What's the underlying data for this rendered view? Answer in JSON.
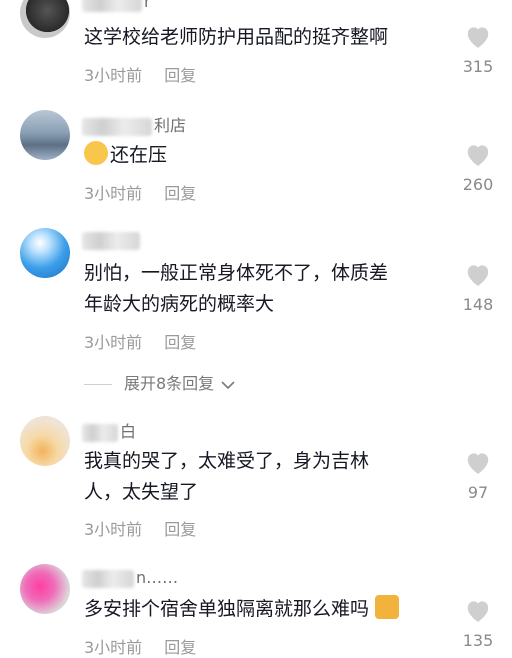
{
  "comments": [
    {
      "name": "r",
      "text_lines": [
        "这学校给老师防护用品配的挺齐整啊"
      ],
      "time": "3小时前",
      "reply": "回复",
      "likes": "315"
    },
    {
      "name": "利店",
      "emoji": "grinning-sweat-emoji",
      "text_lines": [
        "还在压"
      ],
      "time": "3小时前",
      "reply": "回复",
      "likes": "260"
    },
    {
      "name": "",
      "text_lines": [
        "别怕，一般正常身体死不了，体质差",
        "年龄大的病死的概率大"
      ],
      "time": "3小时前",
      "reply": "回复",
      "likes": "148",
      "expand_replies": "展开8条回复"
    },
    {
      "name": "白",
      "text_lines": [
        "我真的哭了，太难受了，身为吉林",
        "人，太失望了"
      ],
      "time": "3小时前",
      "reply": "回复",
      "likes": "97"
    },
    {
      "name": "n……",
      "text_lines": [
        "多安排个宿舍单独隔离就那么难吗"
      ],
      "emoji_end": "cat-emoji",
      "time": "3小时前",
      "reply": "回复",
      "likes": "135"
    }
  ],
  "icons": {
    "like": "heart-icon",
    "expand": "chevron-down-icon"
  },
  "colors": {
    "text": "#161823",
    "secondary": "#9a9a9a",
    "heart": "#cfcfcf"
  }
}
